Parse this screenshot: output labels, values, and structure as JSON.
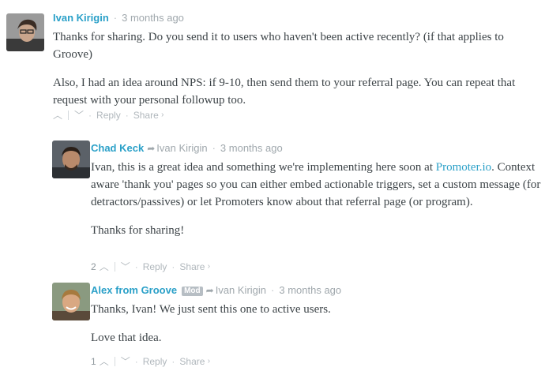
{
  "comments": [
    {
      "author": "Ivan Kirigin",
      "time": "3 months ago",
      "paragraphs": [
        "Thanks for sharing. Do you send it to users who haven't been active recently? (if that applies to Groove)",
        "Also, I had an idea around NPS: if 9-10, then send them to your referral page. You can repeat that request with your personal followup too."
      ],
      "votes": "",
      "reply_label": "Reply",
      "share_label": "Share"
    },
    {
      "author": "Chad Keck",
      "reply_to": "Ivan Kirigin",
      "time": "3 months ago",
      "p1_before_link": "Ivan, this is a great idea and something we're implementing here soon at ",
      "p1_link": "Promoter.io",
      "p1_after_link": ". Context aware 'thank you' pages so you can either embed actionable triggers, set a custom message (for detractors/passives) or let Promoters know about that referral page (or program).",
      "p2": "Thanks for sharing!",
      "votes": "2",
      "reply_label": "Reply",
      "share_label": "Share"
    },
    {
      "author": "Alex from Groove",
      "badge": "Mod",
      "reply_to": "Ivan Kirigin",
      "time": "3 months ago",
      "paragraphs": [
        "Thanks, Ivan! We just sent this one to active users.",
        "Love that idea."
      ],
      "votes": "1",
      "reply_label": "Reply",
      "share_label": "Share"
    }
  ],
  "icons": {
    "upvote": "chevron-up-icon",
    "downvote": "chevron-down-icon",
    "reply_to": "reply-arrow-icon",
    "share_more": "chevron-right-icon"
  },
  "colors": {
    "author": "#2aa0c8",
    "meta": "#a0a8ad",
    "body": "#3d4448",
    "link": "#2aa0c8",
    "badge": "#b7bec4"
  },
  "glyphs": {
    "up": "︿",
    "down": "﹀",
    "arrow": "➦",
    "dot": "·",
    "chev_right": "›"
  }
}
